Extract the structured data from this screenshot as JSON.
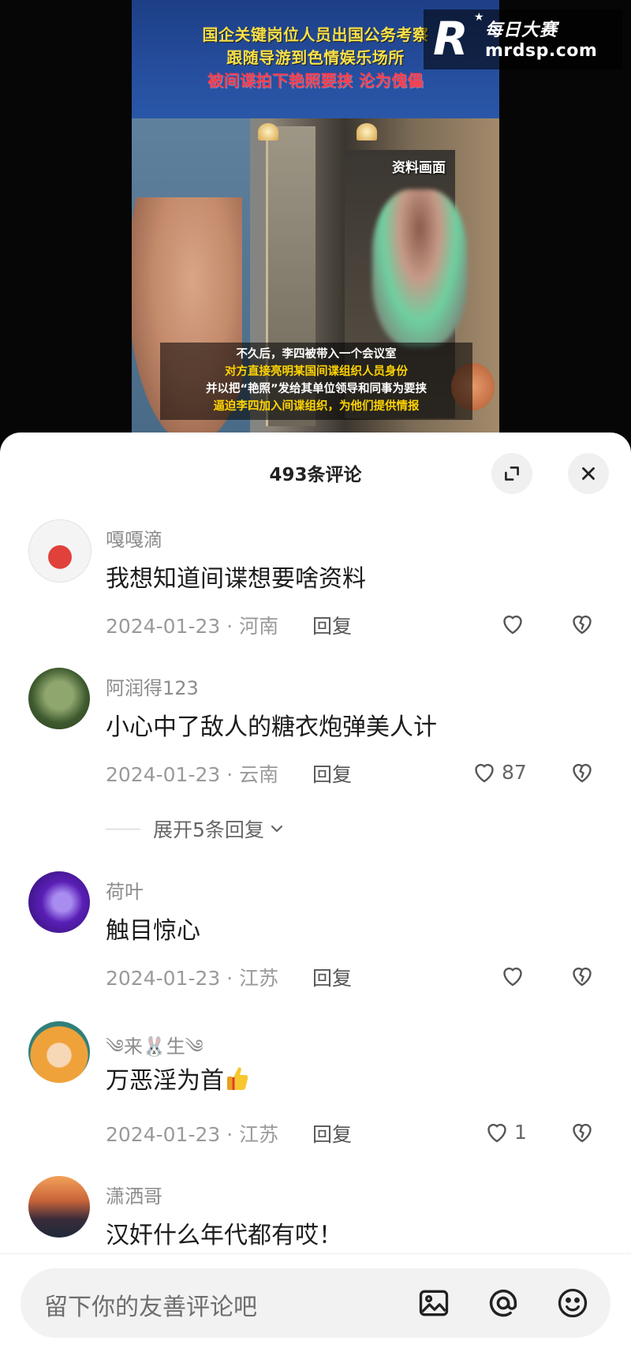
{
  "video": {
    "banner": [
      "国企关键岗位人员出国公务考察",
      "跟随导游到色情娱乐场所",
      "被间谍拍下艳照要挟 沦为傀儡"
    ],
    "tag": "资料画面",
    "subtitles": [
      "不久后，李四被带入一个会议室",
      "对方直接亮明某国间谍组织人员身份",
      "并以把“艳照”发给其单位领导和同事为要挟",
      "逼迫李四加入间谍组织，为他们提供情报"
    ],
    "logo": {
      "letter": "R",
      "name_cn": "每日大赛",
      "url": "mrdsp.com"
    }
  },
  "sheet": {
    "title": "493条评论",
    "expand_icon": "expand-icon",
    "close_icon": "close-icon"
  },
  "comments": [
    {
      "user": "嘎嘎滴",
      "text": "我想知道间谍想要啥资料",
      "date_loc": "2024-01-23 · 河南",
      "reply": "回复",
      "likes": ""
    },
    {
      "user": "阿润得123",
      "text": "小心中了敌人的糖衣炮弹美人计",
      "date_loc": "2024-01-23 · 云南",
      "reply": "回复",
      "likes": "87"
    },
    {
      "user": "荷叶",
      "text": "触目惊心",
      "date_loc": "2024-01-23 · 江苏",
      "reply": "回复",
      "likes": ""
    },
    {
      "user": "༄来🐰生༄",
      "text": "万恶淫为首",
      "date_loc": "2024-01-23 · 江苏",
      "reply": "回复",
      "likes": "1"
    },
    {
      "user": "潇洒哥",
      "text": "汉奸什么年代都有哎！",
      "date_loc": "",
      "reply": "",
      "likes": ""
    }
  ],
  "expand_replies": "展开5条回复",
  "input": {
    "placeholder": "留下你的友善评论吧",
    "icons": [
      "image-icon",
      "at-icon",
      "emoji-icon"
    ]
  },
  "colors": {
    "accent": "#1c1c1c",
    "muted": "#9a9a9a",
    "banner_bg": "#264e9e",
    "banner_text": "#f7e04a",
    "banner_red": "#ff3b4a"
  }
}
